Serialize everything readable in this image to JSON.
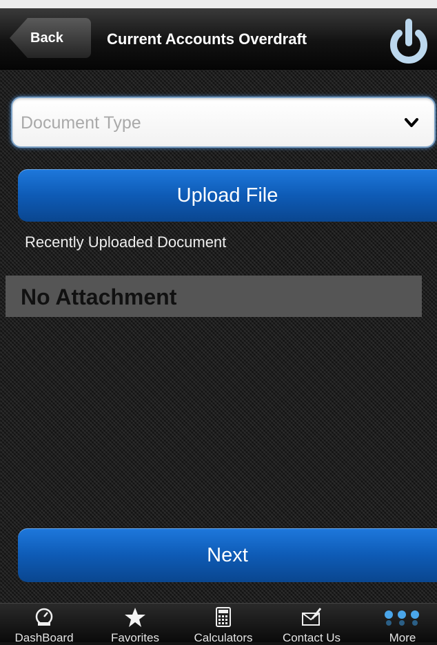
{
  "header": {
    "back_label": "Back",
    "title": "Current Accounts Overdraft",
    "power_icon": "power-icon"
  },
  "form": {
    "document_type_placeholder": "Document Type",
    "upload_label": "Upload File",
    "recent_label": "Recently Uploaded Document",
    "attachment_status": "No Attachment",
    "next_label": "Next"
  },
  "tabs": [
    {
      "label": "DashBoard",
      "icon": "dashboard-icon"
    },
    {
      "label": "Favorites",
      "icon": "star-icon"
    },
    {
      "label": "Calculators",
      "icon": "calculator-icon"
    },
    {
      "label": "Contact Us",
      "icon": "contact-icon"
    },
    {
      "label": "More",
      "icon": "more-icon"
    }
  ],
  "colors": {
    "accent_blue": "#0e5bb6",
    "focus_glow": "#4f8ed1",
    "power_icon": "#bcd8ee"
  }
}
